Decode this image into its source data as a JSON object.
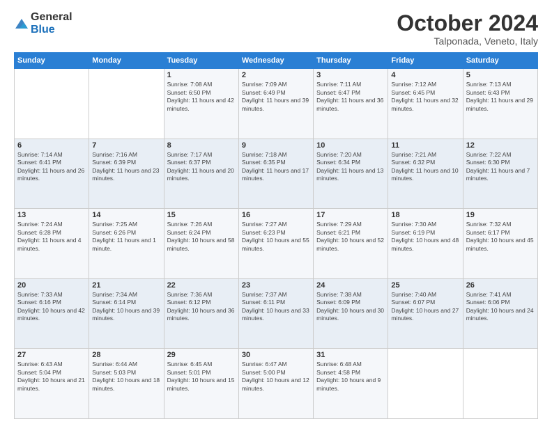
{
  "logo": {
    "general": "General",
    "blue": "Blue"
  },
  "title": "October 2024",
  "subtitle": "Talponada, Veneto, Italy",
  "headers": [
    "Sunday",
    "Monday",
    "Tuesday",
    "Wednesday",
    "Thursday",
    "Friday",
    "Saturday"
  ],
  "weeks": [
    [
      {
        "day": "",
        "sunrise": "",
        "sunset": "",
        "daylight": ""
      },
      {
        "day": "",
        "sunrise": "",
        "sunset": "",
        "daylight": ""
      },
      {
        "day": "1",
        "sunrise": "Sunrise: 7:08 AM",
        "sunset": "Sunset: 6:50 PM",
        "daylight": "Daylight: 11 hours and 42 minutes."
      },
      {
        "day": "2",
        "sunrise": "Sunrise: 7:09 AM",
        "sunset": "Sunset: 6:49 PM",
        "daylight": "Daylight: 11 hours and 39 minutes."
      },
      {
        "day": "3",
        "sunrise": "Sunrise: 7:11 AM",
        "sunset": "Sunset: 6:47 PM",
        "daylight": "Daylight: 11 hours and 36 minutes."
      },
      {
        "day": "4",
        "sunrise": "Sunrise: 7:12 AM",
        "sunset": "Sunset: 6:45 PM",
        "daylight": "Daylight: 11 hours and 32 minutes."
      },
      {
        "day": "5",
        "sunrise": "Sunrise: 7:13 AM",
        "sunset": "Sunset: 6:43 PM",
        "daylight": "Daylight: 11 hours and 29 minutes."
      }
    ],
    [
      {
        "day": "6",
        "sunrise": "Sunrise: 7:14 AM",
        "sunset": "Sunset: 6:41 PM",
        "daylight": "Daylight: 11 hours and 26 minutes."
      },
      {
        "day": "7",
        "sunrise": "Sunrise: 7:16 AM",
        "sunset": "Sunset: 6:39 PM",
        "daylight": "Daylight: 11 hours and 23 minutes."
      },
      {
        "day": "8",
        "sunrise": "Sunrise: 7:17 AM",
        "sunset": "Sunset: 6:37 PM",
        "daylight": "Daylight: 11 hours and 20 minutes."
      },
      {
        "day": "9",
        "sunrise": "Sunrise: 7:18 AM",
        "sunset": "Sunset: 6:35 PM",
        "daylight": "Daylight: 11 hours and 17 minutes."
      },
      {
        "day": "10",
        "sunrise": "Sunrise: 7:20 AM",
        "sunset": "Sunset: 6:34 PM",
        "daylight": "Daylight: 11 hours and 13 minutes."
      },
      {
        "day": "11",
        "sunrise": "Sunrise: 7:21 AM",
        "sunset": "Sunset: 6:32 PM",
        "daylight": "Daylight: 11 hours and 10 minutes."
      },
      {
        "day": "12",
        "sunrise": "Sunrise: 7:22 AM",
        "sunset": "Sunset: 6:30 PM",
        "daylight": "Daylight: 11 hours and 7 minutes."
      }
    ],
    [
      {
        "day": "13",
        "sunrise": "Sunrise: 7:24 AM",
        "sunset": "Sunset: 6:28 PM",
        "daylight": "Daylight: 11 hours and 4 minutes."
      },
      {
        "day": "14",
        "sunrise": "Sunrise: 7:25 AM",
        "sunset": "Sunset: 6:26 PM",
        "daylight": "Daylight: 11 hours and 1 minute."
      },
      {
        "day": "15",
        "sunrise": "Sunrise: 7:26 AM",
        "sunset": "Sunset: 6:24 PM",
        "daylight": "Daylight: 10 hours and 58 minutes."
      },
      {
        "day": "16",
        "sunrise": "Sunrise: 7:27 AM",
        "sunset": "Sunset: 6:23 PM",
        "daylight": "Daylight: 10 hours and 55 minutes."
      },
      {
        "day": "17",
        "sunrise": "Sunrise: 7:29 AM",
        "sunset": "Sunset: 6:21 PM",
        "daylight": "Daylight: 10 hours and 52 minutes."
      },
      {
        "day": "18",
        "sunrise": "Sunrise: 7:30 AM",
        "sunset": "Sunset: 6:19 PM",
        "daylight": "Daylight: 10 hours and 48 minutes."
      },
      {
        "day": "19",
        "sunrise": "Sunrise: 7:32 AM",
        "sunset": "Sunset: 6:17 PM",
        "daylight": "Daylight: 10 hours and 45 minutes."
      }
    ],
    [
      {
        "day": "20",
        "sunrise": "Sunrise: 7:33 AM",
        "sunset": "Sunset: 6:16 PM",
        "daylight": "Daylight: 10 hours and 42 minutes."
      },
      {
        "day": "21",
        "sunrise": "Sunrise: 7:34 AM",
        "sunset": "Sunset: 6:14 PM",
        "daylight": "Daylight: 10 hours and 39 minutes."
      },
      {
        "day": "22",
        "sunrise": "Sunrise: 7:36 AM",
        "sunset": "Sunset: 6:12 PM",
        "daylight": "Daylight: 10 hours and 36 minutes."
      },
      {
        "day": "23",
        "sunrise": "Sunrise: 7:37 AM",
        "sunset": "Sunset: 6:11 PM",
        "daylight": "Daylight: 10 hours and 33 minutes."
      },
      {
        "day": "24",
        "sunrise": "Sunrise: 7:38 AM",
        "sunset": "Sunset: 6:09 PM",
        "daylight": "Daylight: 10 hours and 30 minutes."
      },
      {
        "day": "25",
        "sunrise": "Sunrise: 7:40 AM",
        "sunset": "Sunset: 6:07 PM",
        "daylight": "Daylight: 10 hours and 27 minutes."
      },
      {
        "day": "26",
        "sunrise": "Sunrise: 7:41 AM",
        "sunset": "Sunset: 6:06 PM",
        "daylight": "Daylight: 10 hours and 24 minutes."
      }
    ],
    [
      {
        "day": "27",
        "sunrise": "Sunrise: 6:43 AM",
        "sunset": "Sunset: 5:04 PM",
        "daylight": "Daylight: 10 hours and 21 minutes."
      },
      {
        "day": "28",
        "sunrise": "Sunrise: 6:44 AM",
        "sunset": "Sunset: 5:03 PM",
        "daylight": "Daylight: 10 hours and 18 minutes."
      },
      {
        "day": "29",
        "sunrise": "Sunrise: 6:45 AM",
        "sunset": "Sunset: 5:01 PM",
        "daylight": "Daylight: 10 hours and 15 minutes."
      },
      {
        "day": "30",
        "sunrise": "Sunrise: 6:47 AM",
        "sunset": "Sunset: 5:00 PM",
        "daylight": "Daylight: 10 hours and 12 minutes."
      },
      {
        "day": "31",
        "sunrise": "Sunrise: 6:48 AM",
        "sunset": "Sunset: 4:58 PM",
        "daylight": "Daylight: 10 hours and 9 minutes."
      },
      {
        "day": "",
        "sunrise": "",
        "sunset": "",
        "daylight": ""
      },
      {
        "day": "",
        "sunrise": "",
        "sunset": "",
        "daylight": ""
      }
    ]
  ]
}
